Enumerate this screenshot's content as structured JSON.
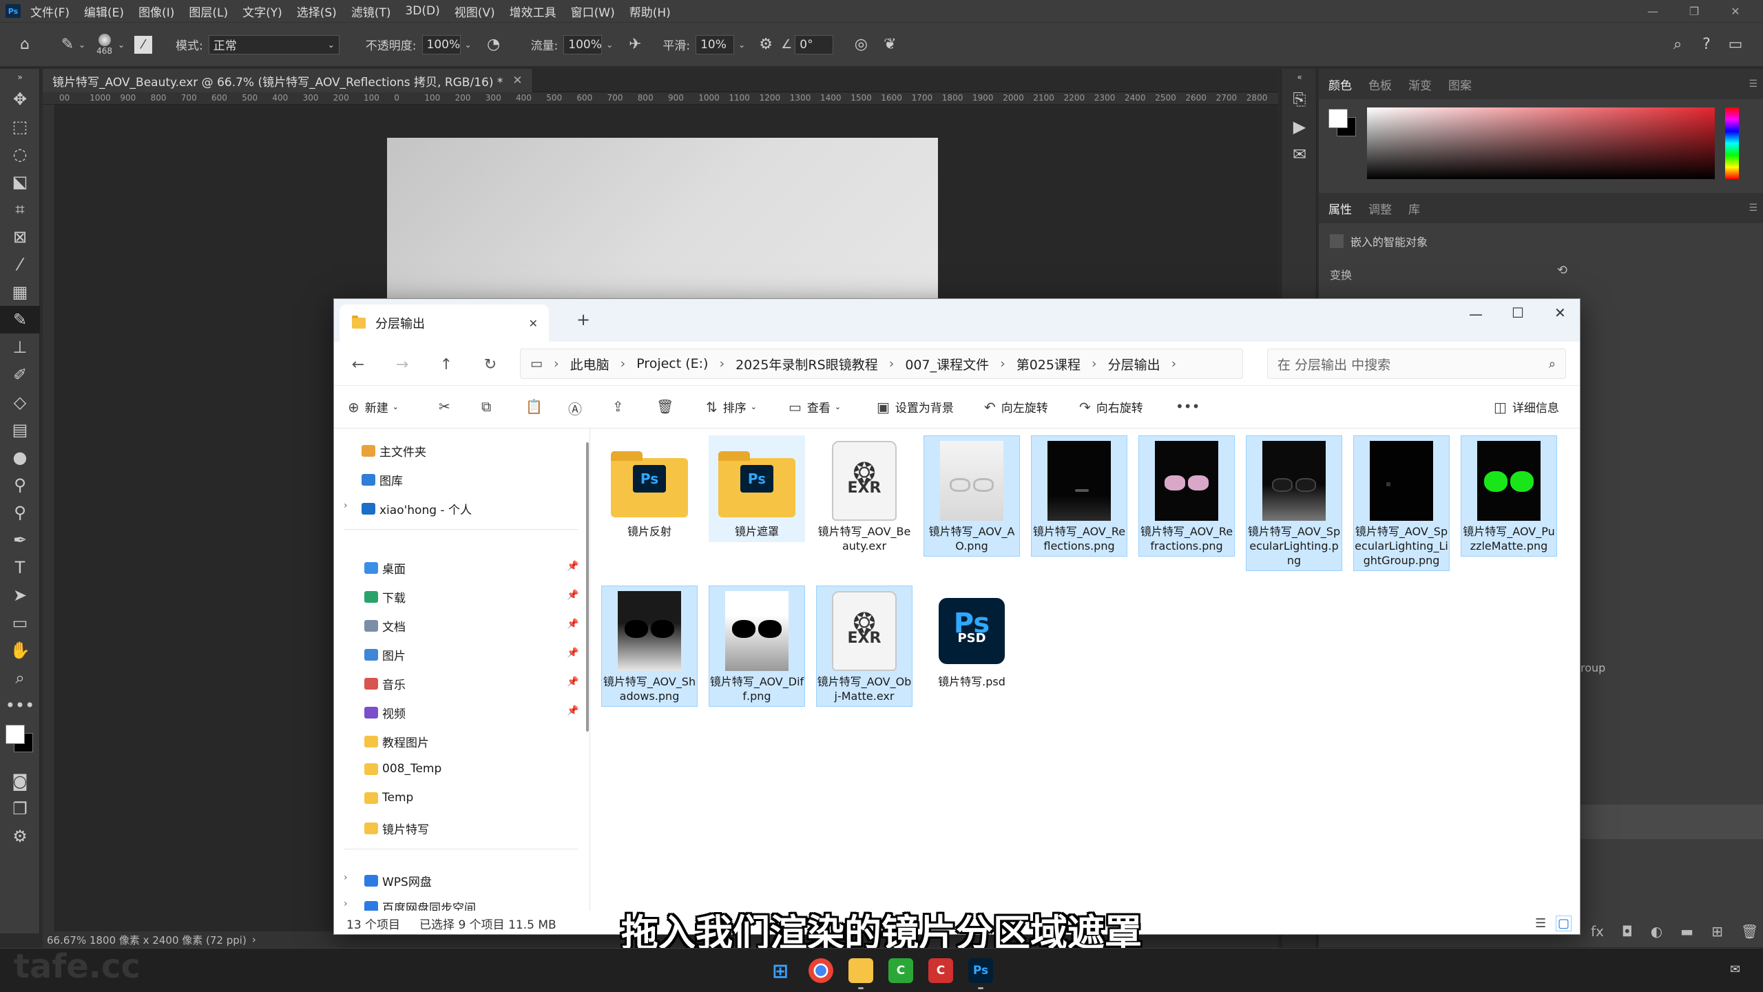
{
  "ps": {
    "menu": [
      "文件(F)",
      "编辑(E)",
      "图像(I)",
      "图层(L)",
      "文字(Y)",
      "选择(S)",
      "滤镜(T)",
      "3D(D)",
      "视图(V)",
      "增效工具",
      "窗口(W)",
      "帮助(H)"
    ],
    "options": {
      "brush_size": "468",
      "mode_label": "模式:",
      "mode_value": "正常",
      "opacity_label": "不透明度:",
      "opacity_value": "100%",
      "flow_label": "流量:",
      "flow_value": "100%",
      "smooth_label": "平滑:",
      "smooth_value": "10%",
      "angle_value": "0°"
    },
    "doc_tab": "镜片特写_AOV_Beauty.exr @ 66.7% (镜片特写_AOV_Reflections 拷贝, RGB/16) *",
    "ruler": [
      "00",
      "1000",
      "900",
      "800",
      "700",
      "600",
      "500",
      "400",
      "300",
      "200",
      "100",
      "0",
      "100",
      "200",
      "300",
      "400",
      "500",
      "600",
      "700",
      "800",
      "900",
      "1000",
      "1100",
      "1200",
      "1300",
      "1400",
      "1500",
      "1600",
      "1700",
      "1800",
      "1900",
      "2000",
      "2100",
      "2200",
      "2300",
      "2400",
      "2500",
      "2600",
      "2700",
      "2800"
    ],
    "status": "66.67%  1800 像素 x 2400 像素 (72 ppi)",
    "panel_tabs_top": [
      "颜色",
      "色板",
      "渐变",
      "图案"
    ],
    "panel_tabs_props": [
      "属性",
      "调整",
      "库"
    ],
    "smart_object": "嵌入的智能对象",
    "transform": "变换",
    "group_label": "roup"
  },
  "explorer": {
    "tab_title": "分层输出",
    "breadcrumb": [
      "此电脑",
      "Project (E:)",
      "2025年录制RS眼镜教程",
      "007_课程文件",
      "第025课程",
      "分层输出"
    ],
    "search_placeholder": "在 分层输出 中搜索",
    "cmd": {
      "new": "新建",
      "sort": "排序",
      "view": "查看",
      "set_bg": "设置为背景",
      "rotate_left": "向左旋转",
      "rotate_right": "向右旋转",
      "details": "详细信息"
    },
    "nav_top": [
      "主文件夹",
      "图库",
      "xiao'hong - 个人"
    ],
    "nav_pinned": [
      "桌面",
      "下载",
      "文档",
      "图片",
      "音乐",
      "视频"
    ],
    "nav_folders": [
      "教程图片",
      "008_Temp",
      "Temp",
      "镜片特写"
    ],
    "nav_bottom": [
      "WPS网盘",
      "百度网盘同步空间"
    ],
    "files": [
      {
        "name": "镜片反射"
      },
      {
        "name": "镜片遮罩"
      },
      {
        "name": "镜片特写_AOV_Beauty.exr"
      },
      {
        "name": "镜片特写_AOV_AO.png"
      },
      {
        "name": "镜片特写_AOV_Reflections.png"
      },
      {
        "name": "镜片特写_AOV_Refractions.png"
      },
      {
        "name": "镜片特写_AOV_SpecularLighting.png"
      },
      {
        "name": "镜片特写_AOV_SpecularLighting_LightGroup.png"
      },
      {
        "name": "镜片特写_AOV_PuzzleMatte.png"
      },
      {
        "name": "镜片特写_AOV_Shadows.png"
      },
      {
        "name": "镜片特写_AOV_Diff.png"
      },
      {
        "name": "镜片特写_AOV_Obj-Matte.exr"
      },
      {
        "name": "镜片特写.psd"
      }
    ],
    "status_count": "13 个项目",
    "status_selected": "已选择 9 个项目  11.5 MB",
    "exr_label": "EXR",
    "ps_label": "Ps",
    "psd_label": "PSD"
  },
  "caption": "拖入我们渲染的镜片分区域遮罩",
  "watermark": "tafe.cc"
}
